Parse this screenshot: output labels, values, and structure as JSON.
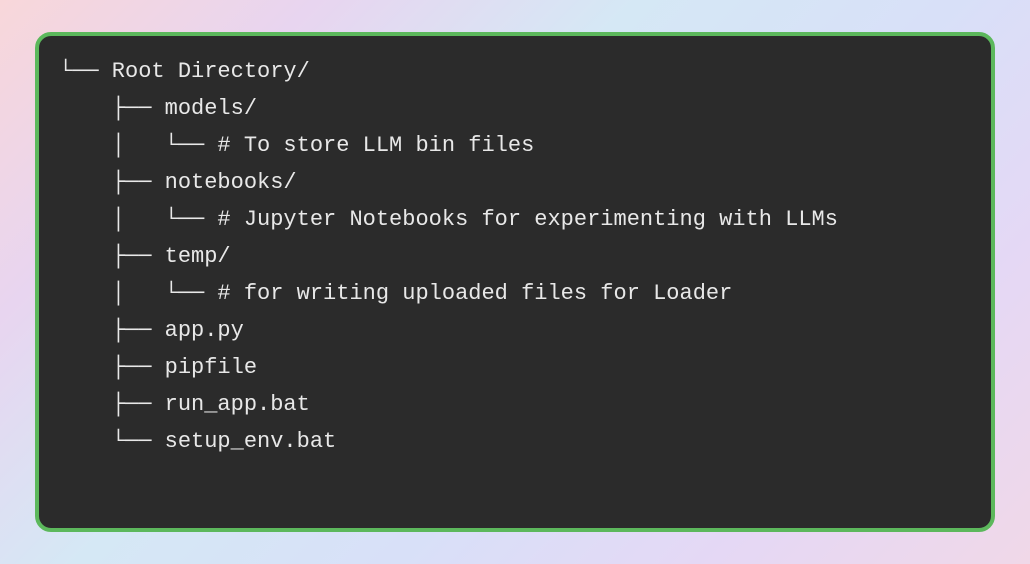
{
  "tree": {
    "lines": [
      "└── Root Directory/",
      "    ├── models/",
      "    │   └── # To store LLM bin files",
      "    ├── notebooks/",
      "    │   └── # Jupyter Notebooks for experimenting with LLMs",
      "    ├── temp/",
      "    │   └── # for writing uploaded files for Loader",
      "    ├── app.py",
      "    ├── pipfile",
      "    ├── run_app.bat",
      "    └── setup_env.bat"
    ]
  }
}
